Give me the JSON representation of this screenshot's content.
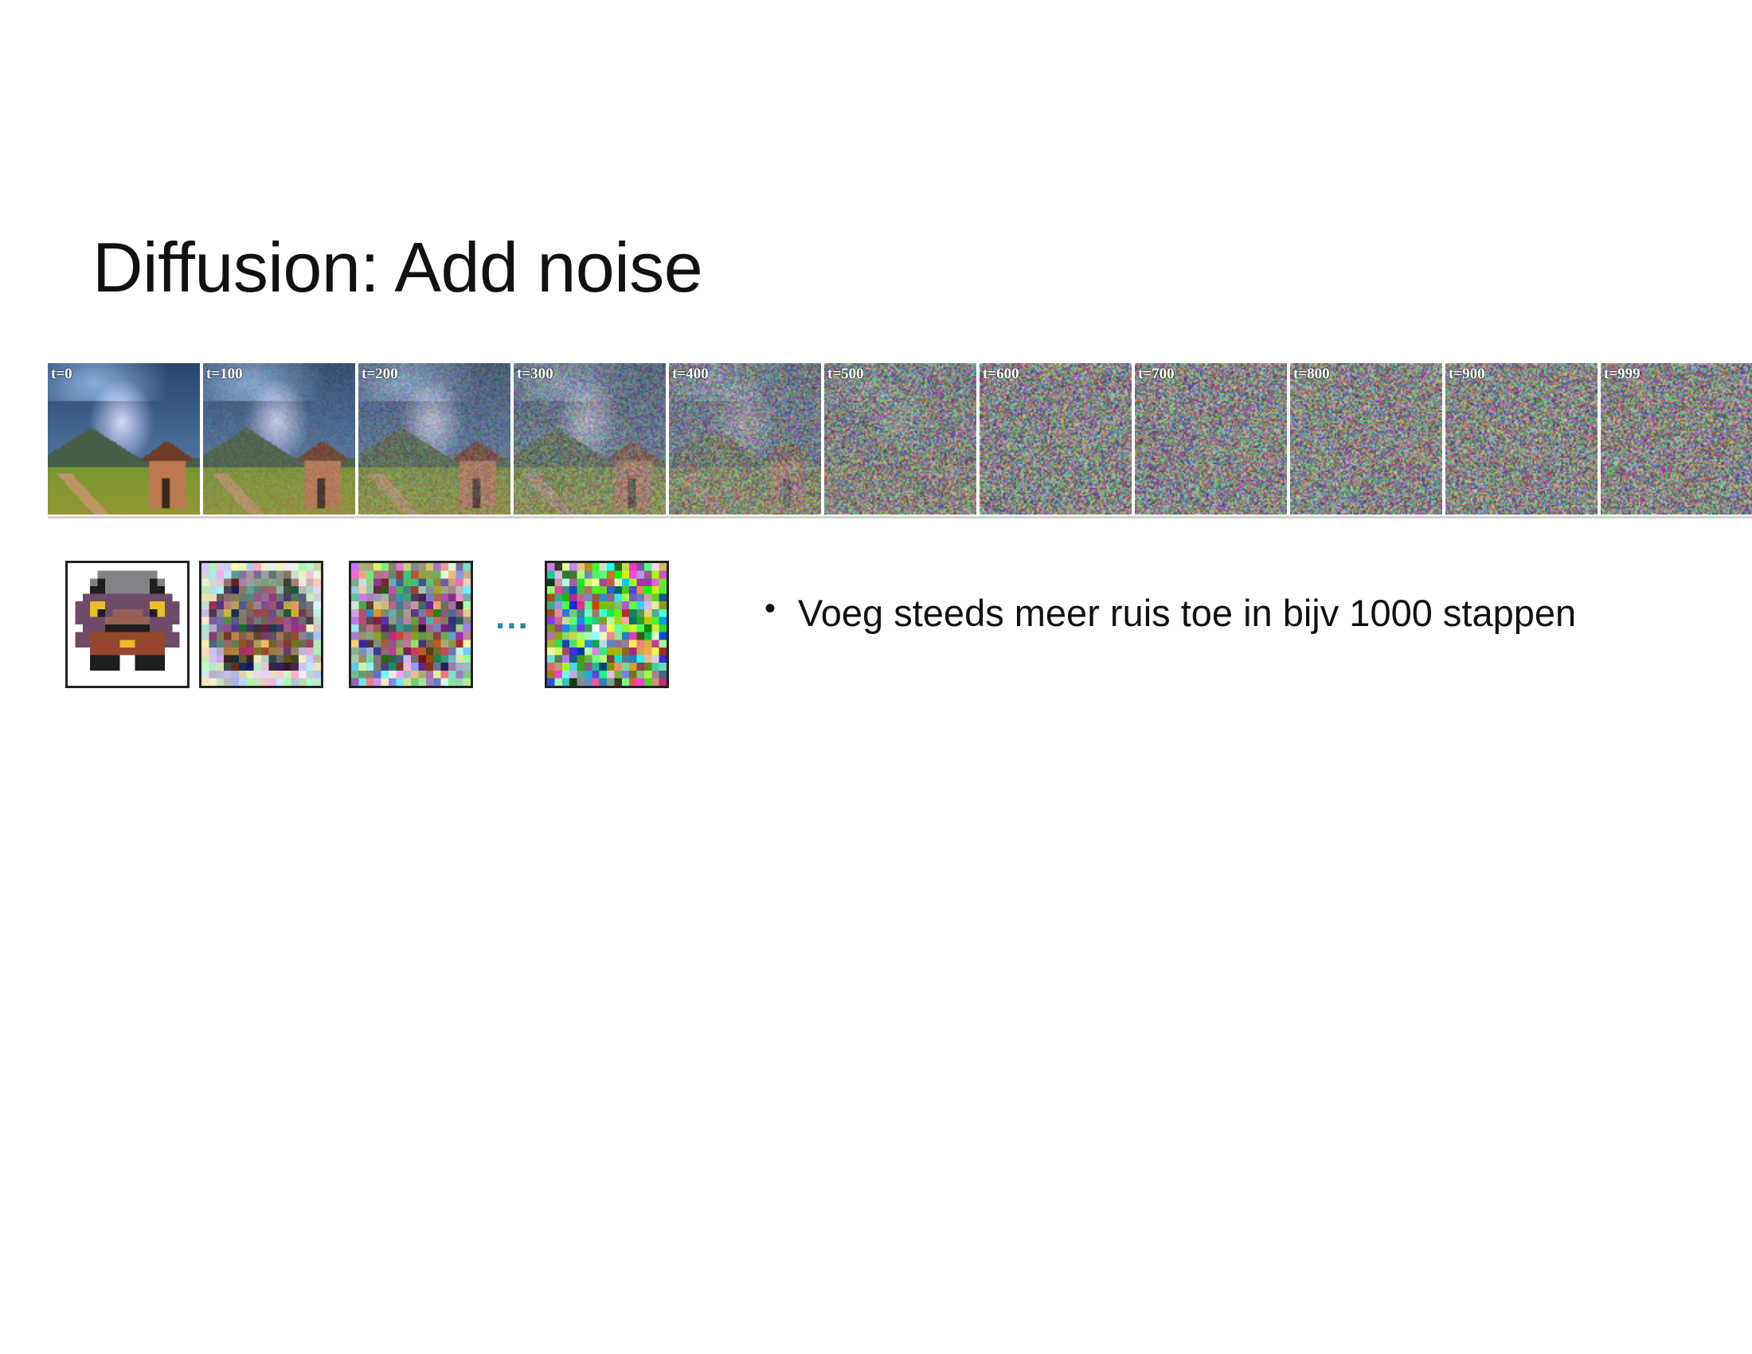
{
  "slide": {
    "title": "Diffusion: Add noise",
    "bullets": [
      "Voeg steeds meer ruis toe in bijv 1000 stappen"
    ]
  },
  "noise_strip": {
    "frames": [
      {
        "label": "t=0",
        "t": 0
      },
      {
        "label": "t=100",
        "t": 100
      },
      {
        "label": "t=200",
        "t": 200
      },
      {
        "label": "t=300",
        "t": 300
      },
      {
        "label": "t=400",
        "t": 400
      },
      {
        "label": "t=500",
        "t": 500
      },
      {
        "label": "t=600",
        "t": 600
      },
      {
        "label": "t=700",
        "t": 700
      },
      {
        "label": "t=800",
        "t": 800
      },
      {
        "label": "t=900",
        "t": 900
      },
      {
        "label": "t=999",
        "t": 999
      }
    ],
    "total_steps": 1000
  },
  "sprite_sequence": {
    "ellipsis": "...",
    "steps": [
      "clean",
      "light-noise",
      "heavy-noise",
      "pure-noise"
    ]
  },
  "colors": {
    "ellipsis": "#2a8aa0",
    "text": "#111111",
    "background": "#ffffff"
  }
}
